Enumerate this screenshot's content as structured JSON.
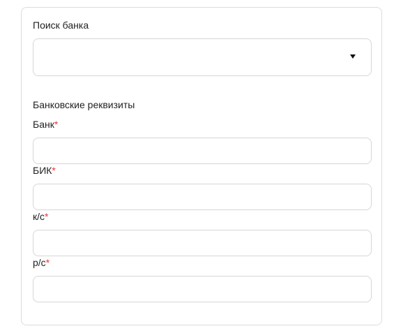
{
  "bank_search": {
    "label": "Поиск банка",
    "selected_value": ""
  },
  "bank_details": {
    "section_title": "Банковские реквизиты",
    "required_mark": "*",
    "fields": [
      {
        "label": "Банк",
        "value": "",
        "placeholder": ""
      },
      {
        "label": "БИК",
        "value": "",
        "placeholder": ""
      },
      {
        "label": "к/с",
        "value": "",
        "placeholder": ""
      },
      {
        "label": "р/с",
        "value": "",
        "placeholder": ""
      }
    ]
  },
  "icons": {
    "dropdown": "caret-down-icon"
  },
  "colors": {
    "required": "#e53935",
    "border": "#d6d6d6",
    "text": "#222222"
  }
}
